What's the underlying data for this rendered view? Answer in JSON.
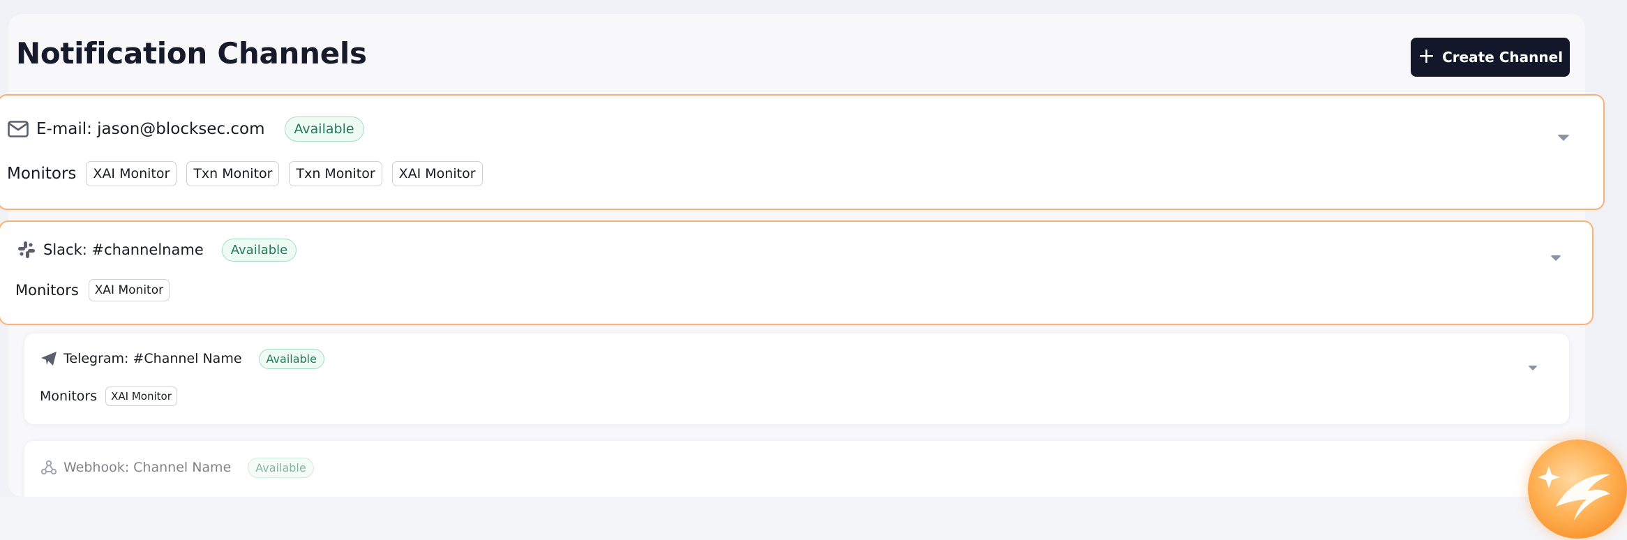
{
  "page": {
    "title": "Notification Channels",
    "create_button": {
      "label": "Create Channel",
      "icon": "plus-icon"
    }
  },
  "channels": [
    {
      "icon": "mail-icon",
      "name": "E-mail: jason@blocksec.com",
      "status": "Available",
      "monitors_label": "Monitors",
      "monitors": [
        "XAI Monitor",
        "Txn Monitor",
        "Txn Monitor",
        "XAI Monitor"
      ],
      "expand_icon": "caret-down-icon"
    },
    {
      "icon": "slack-icon",
      "name": "Slack: #channelname",
      "status": "Available",
      "monitors_label": "Monitors",
      "monitors": [
        "XAI Monitor"
      ],
      "expand_icon": "caret-down-icon"
    },
    {
      "icon": "telegram-icon",
      "name": "Telegram: #Channel Name",
      "status": "Available",
      "monitors_label": "Monitors",
      "monitors": [
        "XAI Monitor"
      ],
      "expand_icon": "caret-down-icon"
    },
    {
      "icon": "webhook-icon",
      "name": "Webhook: Channel Name",
      "status": "Available"
    }
  ],
  "colors": {
    "accent_border": "#f7b27a",
    "badge_green": "#237a55",
    "button_dark": "#121829"
  },
  "assistant": {
    "icon": "sparkle-assistant-icon"
  }
}
